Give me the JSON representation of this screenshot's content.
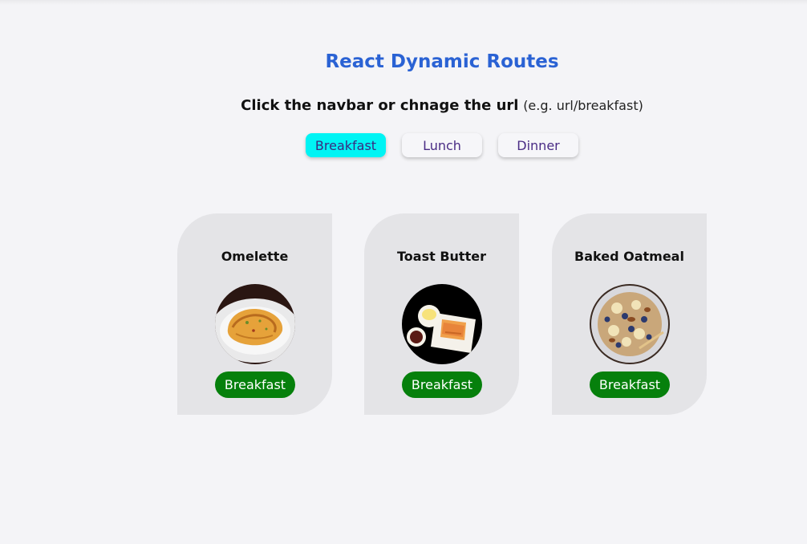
{
  "header": {
    "title": "React Dynamic Routes",
    "instruction": "Click the navbar or chnage the url",
    "example": "(e.g.   url/breakfast)"
  },
  "nav": {
    "items": [
      {
        "label": "Breakfast",
        "active": true
      },
      {
        "label": "Lunch",
        "active": false
      },
      {
        "label": "Dinner",
        "active": false
      }
    ]
  },
  "meals": [
    {
      "name": "Omelette",
      "category": "Breakfast",
      "image": "omelette-image"
    },
    {
      "name": "Toast Butter",
      "category": "Breakfast",
      "image": "toast-butter-image"
    },
    {
      "name": "Baked Oatmeal",
      "category": "Breakfast",
      "image": "baked-oatmeal-image"
    }
  ],
  "colors": {
    "title": "#2a62d4",
    "active_nav": "#00f4f4",
    "tag": "#06800c",
    "card": "#e4e4e7"
  }
}
